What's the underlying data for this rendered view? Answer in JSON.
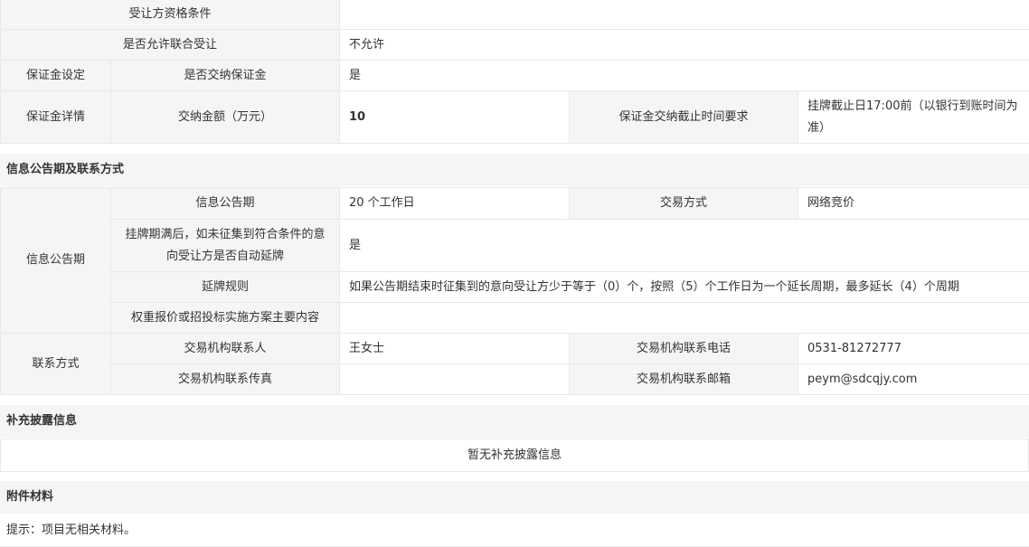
{
  "rows": {
    "qualification_label": "受让方资格条件",
    "qualification_value": "",
    "joint_label": "是否允许联合受让",
    "joint_value": "不允许",
    "deposit_group": "保证金设定",
    "deposit_pay_label": "是否交纳保证金",
    "deposit_pay_value": "是",
    "deposit_detail_group": "保证金详情",
    "amount_label": "交纳金额（万元）",
    "amount_value": "10",
    "deadline_label": "保证金交纳截止时间要求",
    "deadline_value": "挂牌截止日17:00前（以银行到账时间为准）"
  },
  "section_info": {
    "title": "信息公告期及联系方式",
    "info_group": "信息公告期",
    "period_label": "信息公告期",
    "period_value": "20 个工作日",
    "trade_label": "交易方式",
    "trade_value": "网络竞价",
    "extend_label": "挂牌期满后，如未征集到符合条件的意向受让方是否自动延牌",
    "extend_value": "是",
    "rule_label": "延牌规则",
    "rule_value": "如果公告期结束时征集到的意向受让方少于等于（0）个，按照（5）个工作日为一个延长周期，最多延长（4）个周期",
    "weight_label": "权重报价或招投标实施方案主要内容",
    "weight_value": "",
    "contact_group": "联系方式",
    "contact_person_label": "交易机构联系人",
    "contact_person_value": "王女士",
    "phone_label": "交易机构联系电话",
    "phone_value": "0531-81272777",
    "fax_label": "交易机构联系传真",
    "fax_value": "",
    "email_label": "交易机构联系邮箱",
    "email_value": "peym@sdcqjy.com"
  },
  "section_supplement": {
    "title": "补充披露信息",
    "empty_text": "暂无补充披露信息"
  },
  "section_attach": {
    "title": "附件材料",
    "tip": "提示：项目无相关材料。"
  }
}
